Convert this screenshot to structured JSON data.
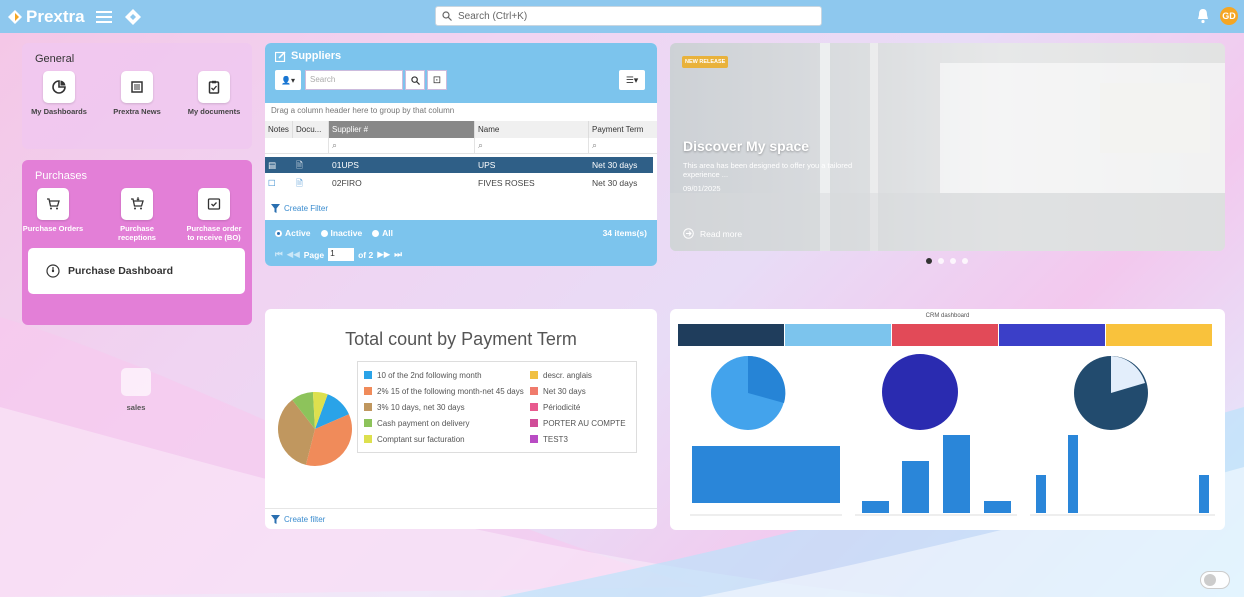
{
  "app": {
    "name": "Prextra",
    "brand_color": "#8ec8ee"
  },
  "topbar": {
    "search_placeholder": "Search (Ctrl+K)",
    "user_initials": "GD"
  },
  "general": {
    "title": "General",
    "tiles": [
      {
        "label": "My Dashboards",
        "icon": "pie-chart-icon"
      },
      {
        "label": "Prextra News",
        "icon": "newspaper-icon"
      },
      {
        "label": "My documents",
        "icon": "clipboard-icon"
      }
    ]
  },
  "purchases": {
    "title": "Purchases",
    "tiles": [
      {
        "label": "Purchase Orders",
        "icon": "cart-icon"
      },
      {
        "label": "Purchase receptions",
        "icon": "cart-receive-icon"
      },
      {
        "label": "Purchase order to receive (BO)",
        "icon": "inbox-check-icon"
      }
    ],
    "dashboard_label": "Purchase Dashboard"
  },
  "sales": {
    "label": "sales"
  },
  "suppliers": {
    "title": "Suppliers",
    "search_placeholder": "Search",
    "drag_hint": "Drag a column header here to group by that column",
    "columns": [
      "Notes",
      "Docu...",
      "Supplier #",
      "Name",
      "Payment Term"
    ],
    "rows": [
      {
        "supplier": "01UPS",
        "name": "UPS",
        "term": "Net 30 days"
      },
      {
        "supplier": "02FIRO",
        "name": "FIVES ROSES",
        "term": "Net 30 days"
      }
    ],
    "create_filter": "Create Filter",
    "radios": [
      "Active",
      "Inactive",
      "All"
    ],
    "items_count": "34 items(s)",
    "page_label": "Page",
    "page_value": "1",
    "page_of": "of 2"
  },
  "news": {
    "badge": "NEW RELEASE",
    "title": "Discover My space",
    "description": "This area has been designed to offer you a tailored experience ...",
    "date": "09/01/2025",
    "read_more": "Read more"
  },
  "payment_chart": {
    "title": "Total count by Payment Term",
    "create_filter": "Create filter",
    "chart_data": {
      "type": "pie",
      "title": "Total count by Payment Term",
      "categories": [
        "10 of the 2nd following month",
        "2% 15 of the following month-net 45 days",
        "3% 10 days, net 30 days",
        "Cash payment on delivery",
        "Comptant sur facturation",
        "descr. anglais",
        "Net 30 days",
        "Périodicité",
        "PORTER AU COMPTE",
        "TEST3"
      ],
      "values": [
        4,
        11,
        11,
        3,
        2,
        0,
        0,
        0,
        0,
        0
      ],
      "colors": [
        "#2aa3e8",
        "#f08b5a",
        "#c0975f",
        "#8dc35b",
        "#dde04e",
        "#f0c043",
        "#f07b6c",
        "#e85a8e",
        "#d04c98",
        "#b94cc4"
      ]
    }
  },
  "crm": {
    "title": "CRM dashboard",
    "kpi_colors": [
      "#1f3d5c",
      "#7cc4ed",
      "#e24a58",
      "#3b3fc8",
      "#f9c23c"
    ]
  }
}
